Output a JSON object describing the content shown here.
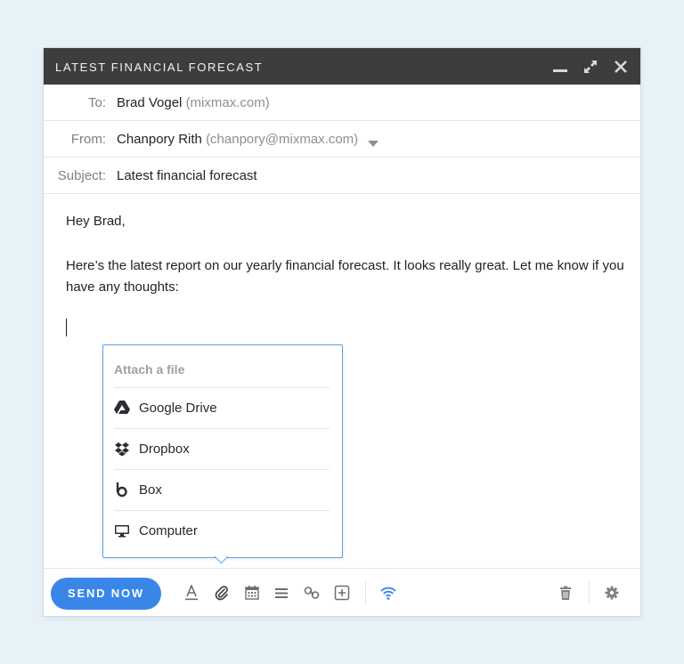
{
  "window": {
    "title": "LATEST FINANCIAL FORECAST"
  },
  "fields": {
    "to_label": "To:",
    "to_name": "Brad Vogel",
    "to_domain": "(mixmax.com)",
    "from_label": "From:",
    "from_name": "Chanpory Rith",
    "from_email": "(chanpory@mixmax.com)",
    "subject_label": "Subject:",
    "subject_value": "Latest financial forecast"
  },
  "body": {
    "greeting": "Hey Brad,",
    "paragraph": "Here’s the latest report on our yearly financial forecast. It looks really great. Let me know if you have any thoughts:"
  },
  "attach_menu": {
    "title": "Attach a file",
    "items": [
      {
        "label": "Google Drive",
        "icon": "google-drive-icon"
      },
      {
        "label": "Dropbox",
        "icon": "dropbox-icon"
      },
      {
        "label": "Box",
        "icon": "box-icon"
      },
      {
        "label": "Computer",
        "icon": "computer-icon"
      }
    ]
  },
  "toolbar": {
    "send_label": "SEND NOW",
    "icons": [
      "text-format-icon",
      "paperclip-icon",
      "calendar-icon",
      "list-icon",
      "link-icon",
      "add-icon",
      "wifi-icon",
      "trash-icon",
      "gear-icon"
    ]
  },
  "colors": {
    "titlebar": "#3d3d3d",
    "accent": "#3a86e8",
    "popover_border": "#5aa0e8",
    "background": "#e6f1f8"
  }
}
